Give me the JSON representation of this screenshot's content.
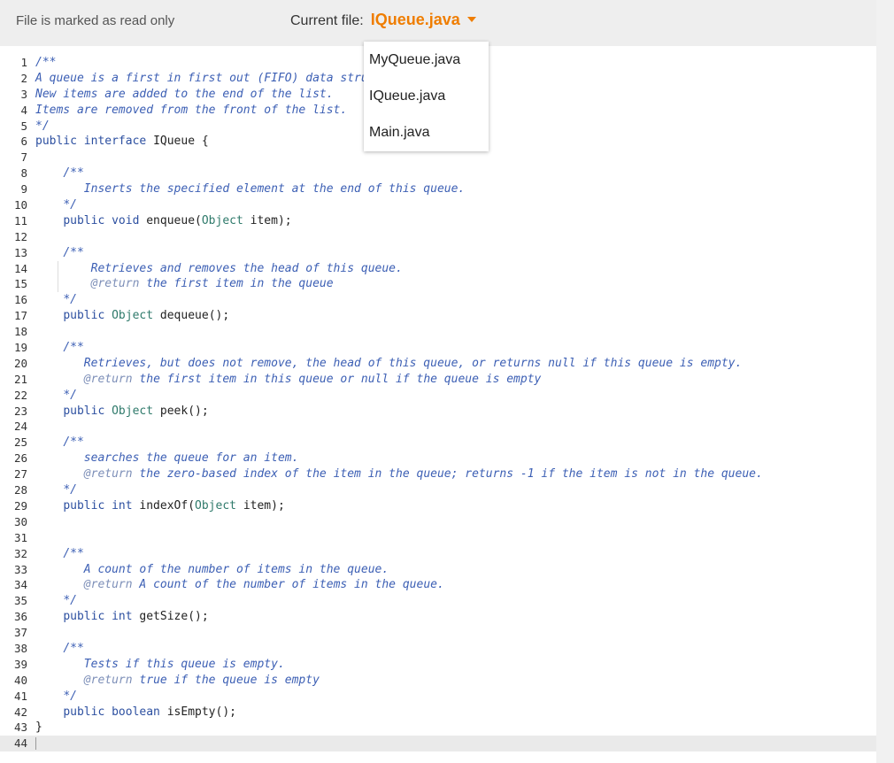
{
  "header": {
    "readonly_text": "File is marked as read only",
    "current_file_label": "Current file:",
    "current_file": "IQueue.java"
  },
  "dropdown": {
    "options": [
      "MyQueue.java",
      "IQueue.java",
      "Main.java"
    ]
  },
  "editor": {
    "lines": [
      [
        [
          "cm",
          "/**"
        ]
      ],
      [
        [
          "cm",
          "A queue is a first in first out (FIFO) data structure."
        ]
      ],
      [
        [
          "cm",
          "New items are added to the end of the list."
        ]
      ],
      [
        [
          "cm",
          "Items are removed from the front of the list."
        ]
      ],
      [
        [
          "cm",
          "*/"
        ]
      ],
      [
        [
          "kw",
          "public interface "
        ],
        [
          "pl",
          "IQueue {"
        ]
      ],
      [],
      [
        [
          "pl",
          "    "
        ],
        [
          "cm",
          "/**"
        ]
      ],
      [
        [
          "pl",
          "       "
        ],
        [
          "cm",
          "Inserts the specified element at the end of this queue."
        ]
      ],
      [
        [
          "pl",
          "    "
        ],
        [
          "cm",
          "*/"
        ]
      ],
      [
        [
          "pl",
          "    "
        ],
        [
          "kw",
          "public void "
        ],
        [
          "pl",
          "enqueue("
        ],
        [
          "ty",
          "Object"
        ],
        [
          "pl",
          " item);"
        ]
      ],
      [],
      [
        [
          "pl",
          "    "
        ],
        [
          "cm",
          "/**"
        ]
      ],
      [
        [
          "pl",
          "        "
        ],
        [
          "cm",
          "Retrieves and removes the head of this queue."
        ]
      ],
      [
        [
          "pl",
          "        "
        ],
        [
          "tag",
          "@return"
        ],
        [
          "cm",
          " the first item in the queue"
        ]
      ],
      [
        [
          "pl",
          "    "
        ],
        [
          "cm",
          "*/"
        ]
      ],
      [
        [
          "pl",
          "    "
        ],
        [
          "kw",
          "public "
        ],
        [
          "ty",
          "Object"
        ],
        [
          "pl",
          " dequeue();"
        ]
      ],
      [],
      [
        [
          "pl",
          "    "
        ],
        [
          "cm",
          "/**"
        ]
      ],
      [
        [
          "pl",
          "       "
        ],
        [
          "cm",
          "Retrieves, but does not remove, the head of this queue, or returns null if this queue is empty."
        ]
      ],
      [
        [
          "pl",
          "       "
        ],
        [
          "tag",
          "@return"
        ],
        [
          "cm",
          " the first item in this queue or null if the queue is empty"
        ]
      ],
      [
        [
          "pl",
          "    "
        ],
        [
          "cm",
          "*/"
        ]
      ],
      [
        [
          "pl",
          "    "
        ],
        [
          "kw",
          "public "
        ],
        [
          "ty",
          "Object"
        ],
        [
          "pl",
          " peek();"
        ]
      ],
      [],
      [
        [
          "pl",
          "    "
        ],
        [
          "cm",
          "/**"
        ]
      ],
      [
        [
          "pl",
          "       "
        ],
        [
          "cm",
          "searches the queue for an item."
        ]
      ],
      [
        [
          "pl",
          "       "
        ],
        [
          "tag",
          "@return"
        ],
        [
          "cm",
          " the zero-based index of the item in the queue; returns -1 if the item is not in the queue."
        ]
      ],
      [
        [
          "pl",
          "    "
        ],
        [
          "cm",
          "*/"
        ]
      ],
      [
        [
          "pl",
          "    "
        ],
        [
          "kw",
          "public int "
        ],
        [
          "pl",
          "indexOf("
        ],
        [
          "ty",
          "Object"
        ],
        [
          "pl",
          " item);"
        ]
      ],
      [],
      [],
      [
        [
          "pl",
          "    "
        ],
        [
          "cm",
          "/**"
        ]
      ],
      [
        [
          "pl",
          "       "
        ],
        [
          "cm",
          "A count of the number of items in the queue."
        ]
      ],
      [
        [
          "pl",
          "       "
        ],
        [
          "tag",
          "@return"
        ],
        [
          "cm",
          " A count of the number of items in the queue."
        ]
      ],
      [
        [
          "pl",
          "    "
        ],
        [
          "cm",
          "*/"
        ]
      ],
      [
        [
          "pl",
          "    "
        ],
        [
          "kw",
          "public int "
        ],
        [
          "pl",
          "getSize();"
        ]
      ],
      [],
      [
        [
          "pl",
          "    "
        ],
        [
          "cm",
          "/**"
        ]
      ],
      [
        [
          "pl",
          "       "
        ],
        [
          "cm",
          "Tests if this queue is empty."
        ]
      ],
      [
        [
          "pl",
          "       "
        ],
        [
          "tag",
          "@return"
        ],
        [
          "cm",
          " true if the queue is empty"
        ]
      ],
      [
        [
          "pl",
          "    "
        ],
        [
          "cm",
          "*/"
        ]
      ],
      [
        [
          "pl",
          "    "
        ],
        [
          "kw",
          "public boolean "
        ],
        [
          "pl",
          "isEmpty();"
        ]
      ],
      [
        [
          "pl",
          "}"
        ]
      ],
      []
    ]
  }
}
